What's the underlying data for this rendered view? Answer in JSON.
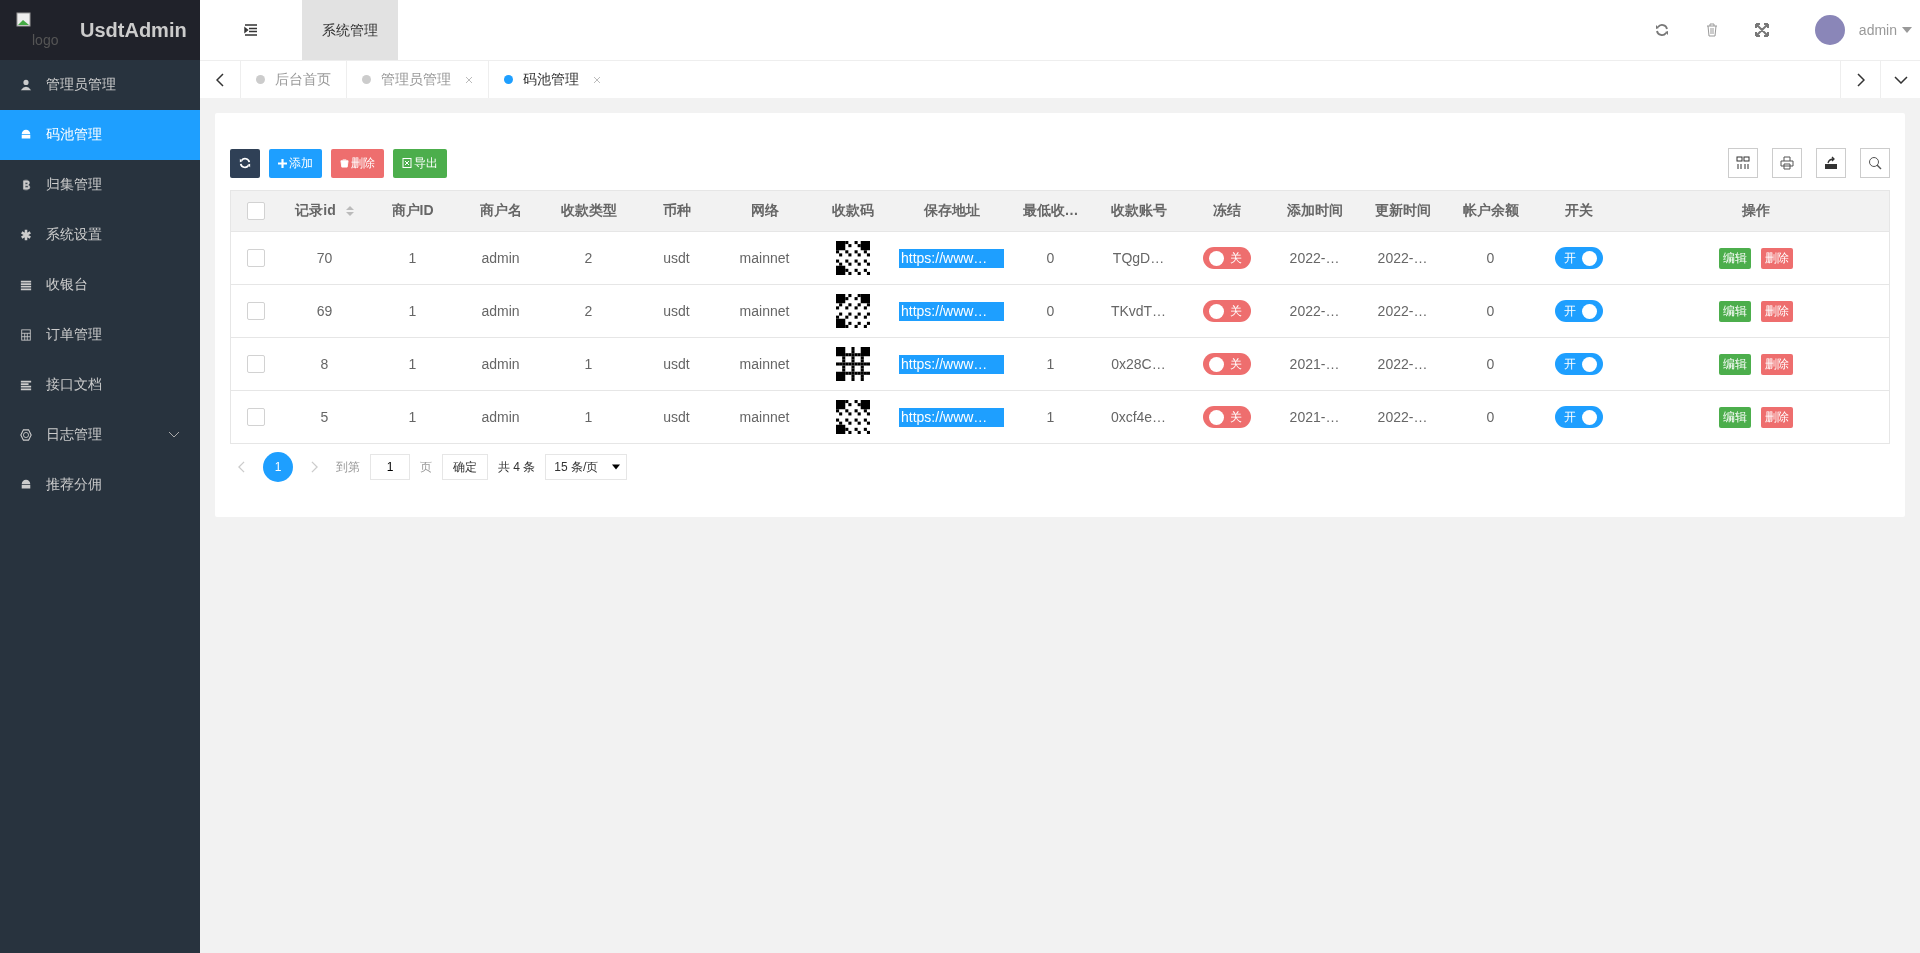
{
  "brand": {
    "logo_alt": "logo",
    "name": "UsdtAdmin"
  },
  "sidebar": {
    "items": [
      {
        "label": "管理员管理",
        "selected": false
      },
      {
        "label": "码池管理",
        "selected": true
      },
      {
        "label": "归集管理",
        "selected": false
      },
      {
        "label": "系统设置",
        "selected": false
      },
      {
        "label": "收银台",
        "selected": false
      },
      {
        "label": "订单管理",
        "selected": false
      },
      {
        "label": "接口文档",
        "selected": false
      },
      {
        "label": "日志管理",
        "selected": false,
        "expanded": false
      },
      {
        "label": "推荐分佣",
        "selected": false
      }
    ]
  },
  "header": {
    "top_tabs": [
      {
        "label": "系统管理",
        "selected": true
      }
    ],
    "user": "admin"
  },
  "tabs": [
    {
      "label": "后台首页",
      "selected": false,
      "closable": false
    },
    {
      "label": "管理员管理",
      "selected": false,
      "closable": true
    },
    {
      "label": "码池管理",
      "selected": true,
      "closable": true
    }
  ],
  "toolbar": {
    "buttons": [
      {
        "kind": "refresh"
      },
      {
        "kind": "add",
        "label": "添加"
      },
      {
        "kind": "delete",
        "label": "删除"
      },
      {
        "kind": "export",
        "label": "导出"
      }
    ]
  },
  "table": {
    "select_all_checked": false,
    "columns": [
      "记录id",
      "商户ID",
      "商户名",
      "收款类型",
      "币种",
      "网络",
      "收款码",
      "保存地址",
      "最低收…",
      "收款账号",
      "冻结",
      "添加时间",
      "更新时间",
      "帐户余额",
      "开关",
      "操作"
    ],
    "rows": [
      {
        "checked": false,
        "id": "70",
        "merchant_id": "1",
        "merchant": "admin",
        "type": "2",
        "coin": "usdt",
        "network": "mainnet",
        "address": "https://www…",
        "min": "0",
        "account": "TQgD…",
        "frozen": false,
        "frozen_label": "关",
        "added": "2022-…",
        "updated": "2022-…",
        "balance": "0",
        "enabled": true,
        "enabled_label": "开",
        "edit": "编辑",
        "delete": "删除"
      },
      {
        "checked": false,
        "id": "69",
        "merchant_id": "1",
        "merchant": "admin",
        "type": "2",
        "coin": "usdt",
        "network": "mainnet",
        "address": "https://www…",
        "min": "0",
        "account": "TKvdT…",
        "frozen": false,
        "frozen_label": "关",
        "added": "2022-…",
        "updated": "2022-…",
        "balance": "0",
        "enabled": true,
        "enabled_label": "开",
        "edit": "编辑",
        "delete": "删除"
      },
      {
        "checked": false,
        "id": "8",
        "merchant_id": "1",
        "merchant": "admin",
        "type": "1",
        "coin": "usdt",
        "network": "mainnet",
        "address": "https://www…",
        "min": "1",
        "account": "0x28C…",
        "frozen": false,
        "frozen_label": "关",
        "added": "2021-…",
        "updated": "2022-…",
        "balance": "0",
        "enabled": true,
        "enabled_label": "开",
        "edit": "编辑",
        "delete": "删除"
      },
      {
        "checked": false,
        "id": "5",
        "merchant_id": "1",
        "merchant": "admin",
        "type": "1",
        "coin": "usdt",
        "network": "mainnet",
        "address": "https://www…",
        "min": "1",
        "account": "0xcf4e…",
        "frozen": false,
        "frozen_label": "关",
        "added": "2021-…",
        "updated": "2022-…",
        "balance": "0",
        "enabled": true,
        "enabled_label": "开",
        "edit": "编辑",
        "delete": "删除"
      }
    ]
  },
  "pagination": {
    "pages": [
      {
        "label": "1",
        "selected": true
      }
    ],
    "goto_label": "到第",
    "goto_value": "1",
    "page_unit": "页",
    "confirm": "确定",
    "total": "共 4 条",
    "page_size": "15 条/页"
  }
}
